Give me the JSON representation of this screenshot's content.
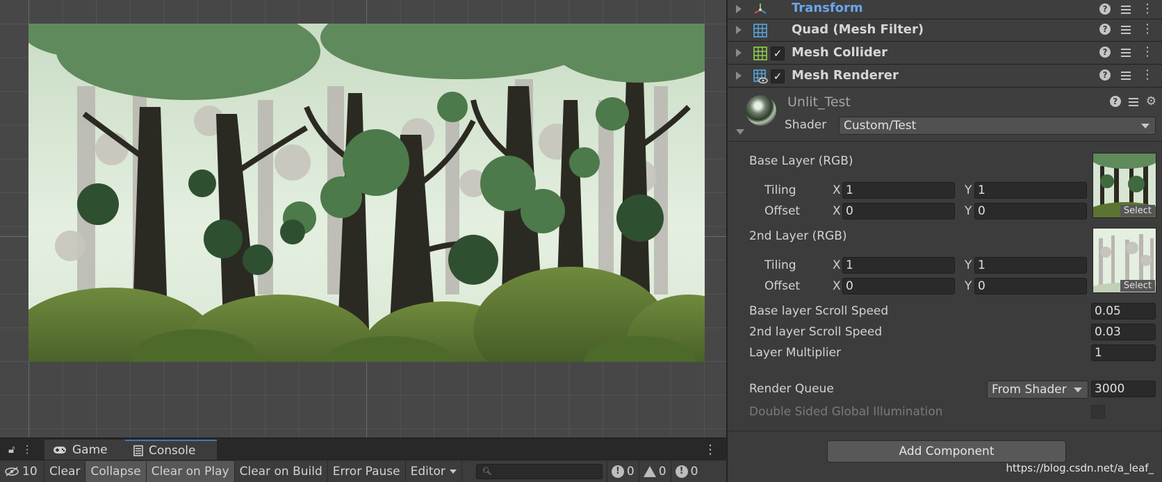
{
  "inspector": {
    "components": [
      {
        "name": "Transform",
        "icon": "transform-icon",
        "checkbox": false
      },
      {
        "name": "Quad (Mesh Filter)",
        "icon": "mesh-filter-icon",
        "checkbox": false
      },
      {
        "name": "Mesh Collider",
        "icon": "mesh-collider-icon",
        "checkbox": true
      },
      {
        "name": "Mesh Renderer",
        "icon": "mesh-renderer-icon",
        "checkbox": true
      }
    ],
    "checkmark": "✓",
    "help_glyph": "?",
    "menu_glyph": "⋮",
    "material": {
      "name": "Unlit_Test",
      "shader_label": "Shader",
      "shader_value": "Custom/Test"
    },
    "base_layer": {
      "label": "Base Layer (RGB)",
      "tiling_label": "Tiling",
      "offset_label": "Offset",
      "tiling_x": "1",
      "tiling_y": "1",
      "offset_x": "0",
      "offset_y": "0",
      "select_label": "Select"
    },
    "second_layer": {
      "label": "2nd Layer (RGB)",
      "tiling_label": "Tiling",
      "offset_label": "Offset",
      "tiling_x": "1",
      "tiling_y": "1",
      "offset_x": "0",
      "offset_y": "0",
      "select_label": "Select"
    },
    "axis_x": "X",
    "axis_y": "Y",
    "base_scroll": {
      "label": "Base layer Scroll Speed",
      "value": "0.05"
    },
    "second_scroll": {
      "label": "2nd layer Scroll Speed",
      "value": "0.03"
    },
    "multiplier": {
      "label": "Layer Multiplier",
      "value": "1"
    },
    "render_queue": {
      "label": "Render Queue",
      "mode": "From Shader",
      "value": "3000"
    },
    "double_sided": {
      "label": "Double Sided Global Illumination"
    },
    "add_component": "Add Component",
    "watermark": "https://blog.csdn.net/a_leaf_"
  },
  "console": {
    "tabs": [
      {
        "label": "Game",
        "icon": "gamepad-icon"
      },
      {
        "label": "Console",
        "icon": "console-icon"
      }
    ],
    "hidden_count": "10",
    "buttons": {
      "clear": "Clear",
      "collapse": "Collapse",
      "clear_on_play": "Clear on Play",
      "clear_on_build": "Clear on Build",
      "error_pause": "Error Pause",
      "editor": "Editor"
    },
    "log_count": "0",
    "warning_count": "0",
    "error_count": "0"
  },
  "colors": {
    "accent_blue": "#6aa5ec",
    "panel_bg": "#3c3c3c",
    "scene_bg": "#474747"
  }
}
